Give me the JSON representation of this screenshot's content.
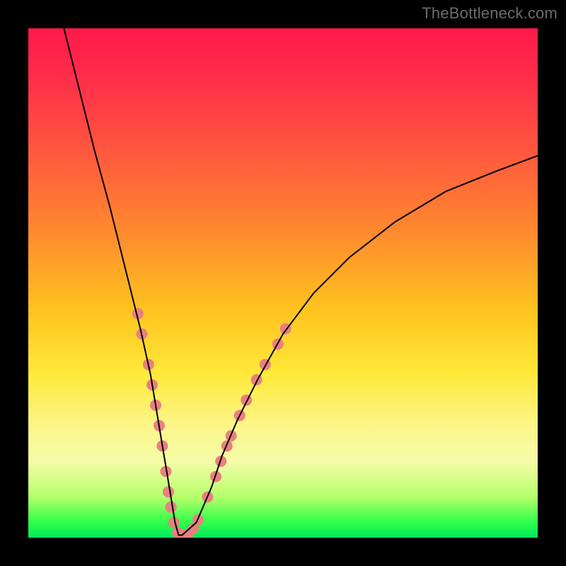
{
  "watermark": "TheBottleneck.com",
  "chart_data": {
    "type": "line",
    "title": "",
    "xlabel": "",
    "ylabel": "",
    "xlim": [
      0,
      100
    ],
    "ylim": [
      0,
      100
    ],
    "grid": false,
    "legend": false,
    "background_gradient": {
      "direction": "vertical",
      "stops": [
        {
          "pos": 0,
          "color": "#ff1a4a"
        },
        {
          "pos": 25,
          "color": "#ff5a3e"
        },
        {
          "pos": 55,
          "color": "#ffc21f"
        },
        {
          "pos": 78,
          "color": "#fcf68a"
        },
        {
          "pos": 97,
          "color": "#2fff4a"
        },
        {
          "pos": 100,
          "color": "#00e85e"
        }
      ]
    },
    "series": [
      {
        "name": "bottleneck-curve",
        "color": "#000000",
        "stroke_width": 2,
        "x": [
          7,
          10,
          13,
          16,
          18,
          20,
          22,
          24,
          25,
          26,
          27,
          28,
          28.8,
          29.5,
          30.2,
          33,
          36,
          38,
          41,
          45,
          50,
          56,
          63,
          72,
          82,
          92,
          100
        ],
        "y": [
          100,
          88,
          76,
          65,
          57,
          49,
          41,
          32,
          26,
          20,
          14,
          8,
          3,
          0.5,
          0.5,
          3,
          10,
          16,
          23,
          31,
          40,
          48,
          55,
          62,
          68,
          72,
          75
        ]
      }
    ],
    "markers": {
      "name": "highlight-dots",
      "color": "#e98080",
      "radius": 8,
      "points": [
        {
          "x": 21.5,
          "y": 44
        },
        {
          "x": 22.3,
          "y": 40
        },
        {
          "x": 23.6,
          "y": 34
        },
        {
          "x": 24.3,
          "y": 30
        },
        {
          "x": 25.0,
          "y": 26
        },
        {
          "x": 25.7,
          "y": 22
        },
        {
          "x": 26.3,
          "y": 18
        },
        {
          "x": 27.0,
          "y": 13
        },
        {
          "x": 27.5,
          "y": 9
        },
        {
          "x": 28.0,
          "y": 6
        },
        {
          "x": 28.6,
          "y": 3
        },
        {
          "x": 29.3,
          "y": 1
        },
        {
          "x": 30.3,
          "y": 0.5
        },
        {
          "x": 31.4,
          "y": 0.7
        },
        {
          "x": 32.4,
          "y": 1.8
        },
        {
          "x": 33.3,
          "y": 3.5
        },
        {
          "x": 35.2,
          "y": 8
        },
        {
          "x": 36.8,
          "y": 12
        },
        {
          "x": 37.8,
          "y": 15
        },
        {
          "x": 39.0,
          "y": 18
        },
        {
          "x": 39.8,
          "y": 20
        },
        {
          "x": 41.5,
          "y": 24
        },
        {
          "x": 42.8,
          "y": 27
        },
        {
          "x": 44.8,
          "y": 31
        },
        {
          "x": 46.5,
          "y": 34
        },
        {
          "x": 49.0,
          "y": 38
        },
        {
          "x": 50.5,
          "y": 41
        }
      ]
    }
  }
}
